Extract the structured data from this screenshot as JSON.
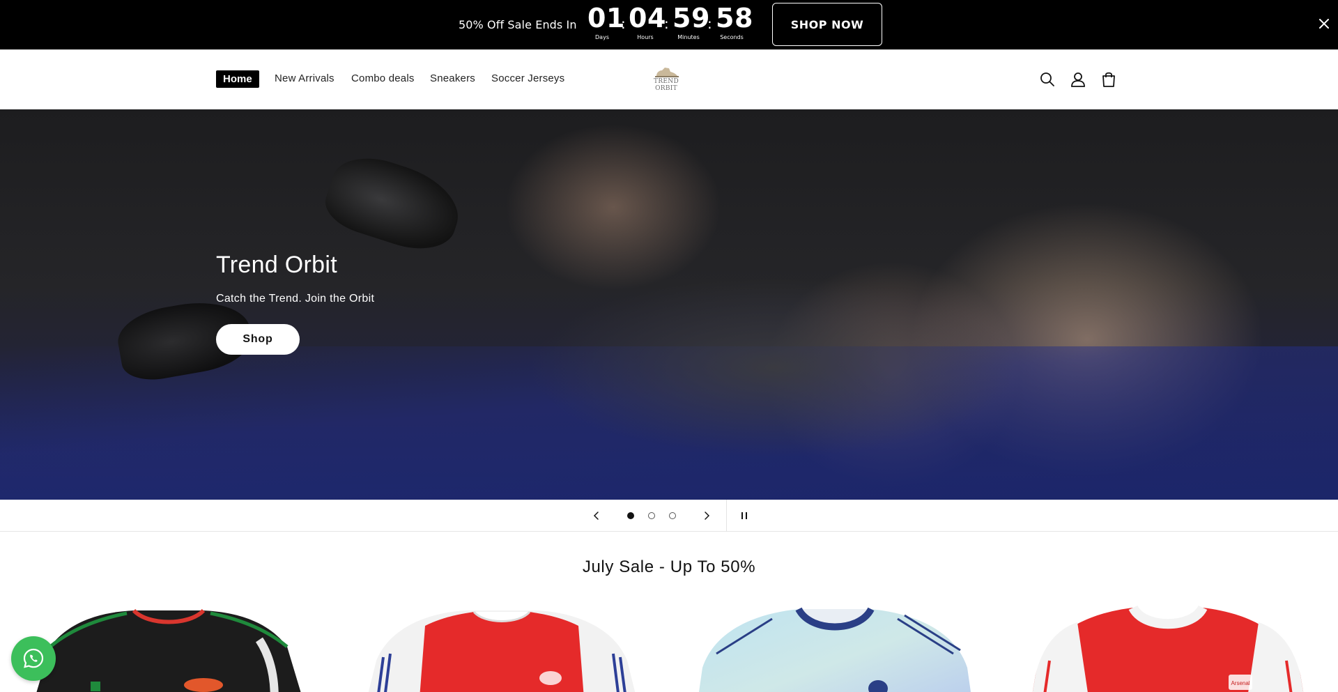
{
  "announcement": {
    "text": "50% Off Sale Ends In",
    "countdown": [
      {
        "value": "01",
        "label": "Days"
      },
      {
        "value": "04",
        "label": "Hours"
      },
      {
        "value": "59",
        "label": "Minutes"
      },
      {
        "value": "58",
        "label": "Seconds"
      }
    ],
    "separator": ":",
    "cta_label": "SHOP NOW"
  },
  "header": {
    "nav": [
      {
        "label": "Home",
        "active": true
      },
      {
        "label": "New Arrivals"
      },
      {
        "label": "Combo deals"
      },
      {
        "label": "Sneakers"
      },
      {
        "label": "Soccer Jerseys"
      }
    ],
    "logo_text": "TREND ORBIT",
    "icons": [
      "search-icon",
      "account-icon",
      "cart-icon"
    ]
  },
  "hero": {
    "title": "Trend Orbit",
    "subtitle": "Catch the Trend. Join the Orbit",
    "button_label": "Shop"
  },
  "slider": {
    "slide_count": 3,
    "active_slide": 1
  },
  "sale_section": {
    "title": "July Sale - Up To 50%",
    "products": [
      {
        "name": "black-jersey",
        "primary": "#1c1c1c",
        "accent": "#1f8a3c"
      },
      {
        "name": "red-white-jersey-blue-trim",
        "primary": "#e52a2a",
        "accent": "#2d3f97"
      },
      {
        "name": "light-blue-jersey",
        "primary": "#b9d9ec",
        "accent": "#2a3f86"
      },
      {
        "name": "red-white-jersey",
        "primary": "#e52a2a",
        "accent": "#ffffff"
      }
    ]
  },
  "colors": {
    "announcement_bg": "#000000",
    "whatsapp_green": "#3cbf5b"
  }
}
